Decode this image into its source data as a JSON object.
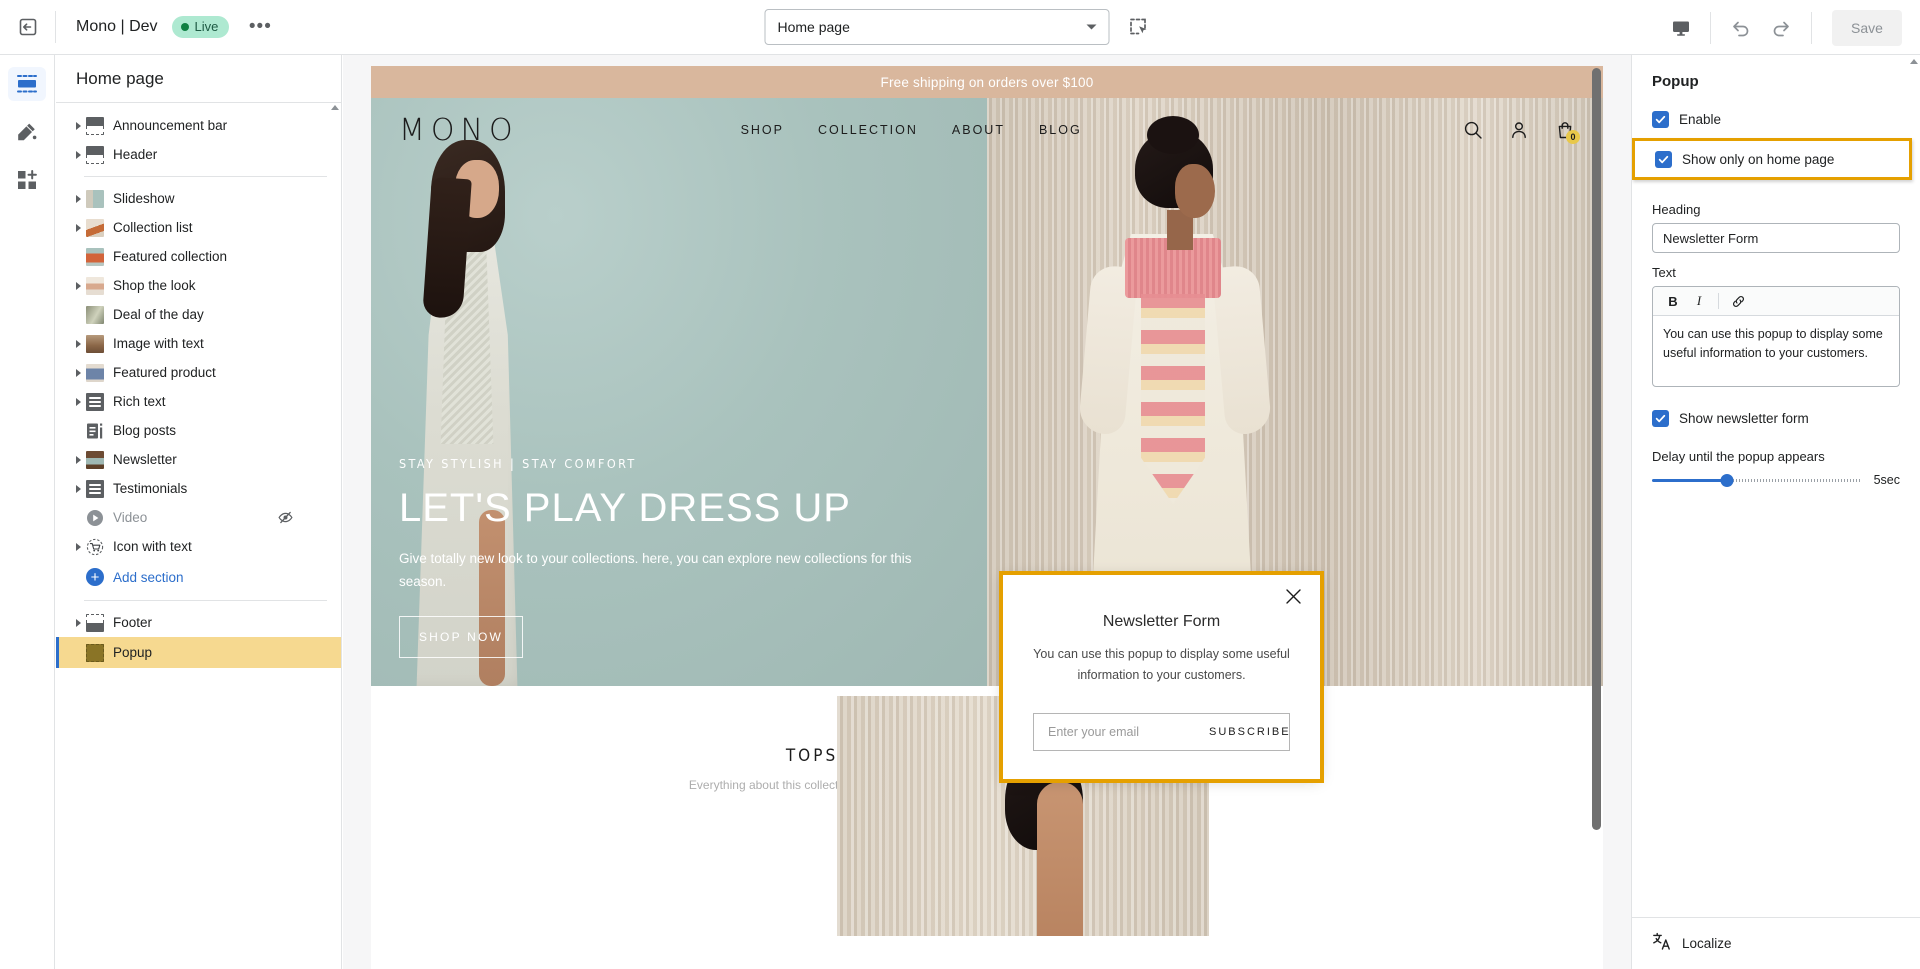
{
  "topbar": {
    "exit_icon": "exit-arrow-icon",
    "shop_name": "Mono | Dev",
    "status_badge": "Live",
    "more_label": "•••",
    "page_selector_value": "Home page",
    "inspector_icon": "select-element-icon",
    "device_icon": "desktop-icon",
    "undo_icon": "undo-icon",
    "redo_icon": "redo-icon",
    "save_label": "Save"
  },
  "rail": {
    "items": [
      {
        "name": "sections-icon",
        "label": "Sections",
        "active": true
      },
      {
        "name": "theme-settings-icon",
        "label": "Theme settings",
        "active": false
      },
      {
        "name": "app-embeds-icon",
        "label": "App embeds",
        "active": false
      }
    ]
  },
  "sidebar": {
    "title": "Home page",
    "sections": [
      {
        "label": "Announcement bar",
        "caret": true,
        "thumb": "t-announce",
        "hidden": false,
        "selected": false
      },
      {
        "label": "Header",
        "caret": true,
        "thumb": "t-announce",
        "hidden": false,
        "selected": false
      },
      {
        "label": "Slideshow",
        "caret": true,
        "thumb": "t-img-slideshow",
        "hidden": false,
        "selected": false
      },
      {
        "label": "Collection list",
        "caret": true,
        "thumb": "t-img-collection",
        "hidden": false,
        "selected": false
      },
      {
        "label": "Featured collection",
        "caret": false,
        "thumb": "t-img-featured",
        "hidden": false,
        "selected": false
      },
      {
        "label": "Shop the look",
        "caret": true,
        "thumb": "t-img-shoplook",
        "hidden": false,
        "selected": false
      },
      {
        "label": "Deal of the day",
        "caret": false,
        "thumb": "t-img-deal",
        "hidden": false,
        "selected": false
      },
      {
        "label": "Image with text",
        "caret": true,
        "thumb": "t-img-imgtext",
        "hidden": false,
        "selected": false
      },
      {
        "label": "Featured product",
        "caret": true,
        "thumb": "t-img-product",
        "hidden": false,
        "selected": false
      },
      {
        "label": "Rich text",
        "caret": true,
        "thumb": "t-rich",
        "hidden": false,
        "selected": false
      },
      {
        "label": "Blog posts",
        "caret": false,
        "thumb": "t-blog",
        "hidden": false,
        "selected": false
      },
      {
        "label": "Newsletter",
        "caret": true,
        "thumb": "t-img-newsletter",
        "hidden": false,
        "selected": false
      },
      {
        "label": "Testimonials",
        "caret": true,
        "thumb": "t-testi",
        "hidden": false,
        "selected": false
      },
      {
        "label": "Video",
        "caret": false,
        "thumb": "t-video",
        "hidden": true,
        "selected": false
      },
      {
        "label": "Icon with text",
        "caret": true,
        "thumb": "t-iconwithtext",
        "hidden": false,
        "selected": false
      }
    ],
    "add_section_label": "Add section",
    "footer_label": "Footer",
    "popup_label": "Popup"
  },
  "preview": {
    "announcement": "Free shipping on orders over $100",
    "brand": "MONO",
    "nav": [
      "SHOP",
      "COLLECTION",
      "ABOUT",
      "BLOG"
    ],
    "cart_count": "0",
    "hero": {
      "kicker": "STAY STYLISH | STAY COMFORT",
      "headline": "LET'S PLAY DRESS UP",
      "subcopy": "Give totally new look to your collections. here, you can explore new collections for this season.",
      "cta": "SHOP NOW"
    },
    "tops": {
      "title": "TOPS",
      "subtitle": "Everything about this collection you need to fill"
    },
    "newsletter_popup": {
      "title": "Newsletter Form",
      "body": "You can use this popup to display some useful information to your customers.",
      "email_placeholder": "Enter your email",
      "subscribe_label": "SUBSCRIBE",
      "close_icon": "close-icon"
    }
  },
  "settings": {
    "panel_title": "Popup",
    "enable_label": "Enable",
    "enable_checked": true,
    "show_home_label": "Show only on home page",
    "show_home_checked": true,
    "heading_label": "Heading",
    "heading_value": "Newsletter Form",
    "text_label": "Text",
    "rte_bold": "B",
    "rte_italic": "I",
    "rte_link_icon": "link-icon",
    "text_value": "You can use this popup to display some useful information to your customers.",
    "show_form_label": "Show newsletter form",
    "show_form_checked": true,
    "delay_label": "Delay until the popup appears",
    "delay_value": "5sec",
    "delay_percent": 36,
    "localize_label": "Localize",
    "localize_icon": "translate-icon"
  },
  "colors": {
    "accent_blue": "#2c6ecb",
    "highlight_gold": "#e5a000",
    "selected_row": "#f6d990",
    "live_green": "#108043",
    "announce_bg": "#d9b79d"
  }
}
